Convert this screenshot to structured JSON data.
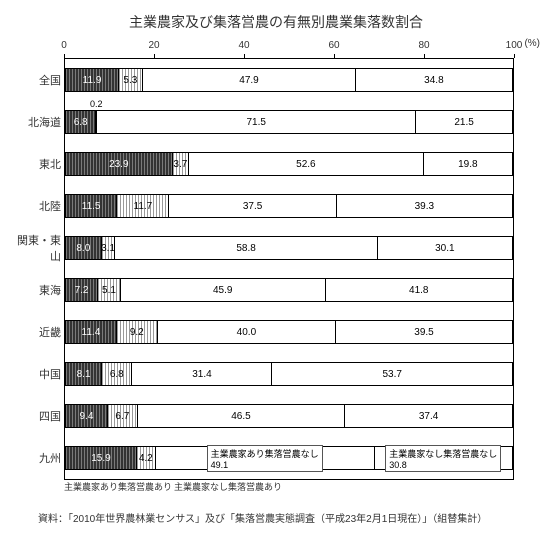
{
  "title": "主業農家及び集落営農の有無別農業集落数割合",
  "unit": "(%)",
  "ticks": [
    0,
    20,
    40,
    60,
    80,
    100
  ],
  "series_names": [
    "主業農家あり集落営農あり",
    "主業農家なし集落営農あり",
    "主業農家あり集落営農なし",
    "主業農家なし集落営農なし"
  ],
  "callout_left": "主業農家あり集落営農あり",
  "callout_right": "主業農家なし集落営農あり",
  "source": "資料：「2010年世界農林業センサス」及び「集落営農実態調査（平成23年2月1日現在）」（組替集計）",
  "chart_data": {
    "type": "bar",
    "orientation": "horizontal_stacked",
    "xlabel": "",
    "ylabel": "",
    "xlim": [
      0,
      100
    ],
    "categories": [
      "全国",
      "北海道",
      "東北",
      "北陸",
      "関東・東山",
      "東海",
      "近畿",
      "中国",
      "四国",
      "九州"
    ],
    "series": [
      {
        "name": "主業農家あり集落営農あり",
        "values": [
          11.9,
          6.8,
          23.9,
          11.5,
          8.0,
          7.2,
          11.4,
          8.1,
          9.4,
          15.9
        ]
      },
      {
        "name": "主業農家なし集落営農あり",
        "values": [
          5.3,
          0.2,
          3.7,
          11.7,
          3.1,
          5.1,
          9.2,
          6.8,
          6.7,
          4.2
        ]
      },
      {
        "name": "主業農家あり集落営農なし",
        "values": [
          47.9,
          71.5,
          52.6,
          37.5,
          58.8,
          45.9,
          40.0,
          31.4,
          46.5,
          49.1
        ]
      },
      {
        "name": "主業農家なし集落営農なし",
        "values": [
          34.8,
          21.5,
          19.8,
          39.3,
          30.1,
          41.8,
          39.5,
          53.7,
          37.4,
          30.8
        ]
      }
    ],
    "last_row_boxed_labels": {
      "2": "主業農家あり集落営農なし",
      "3": "主業農家なし集落営農なし"
    }
  }
}
